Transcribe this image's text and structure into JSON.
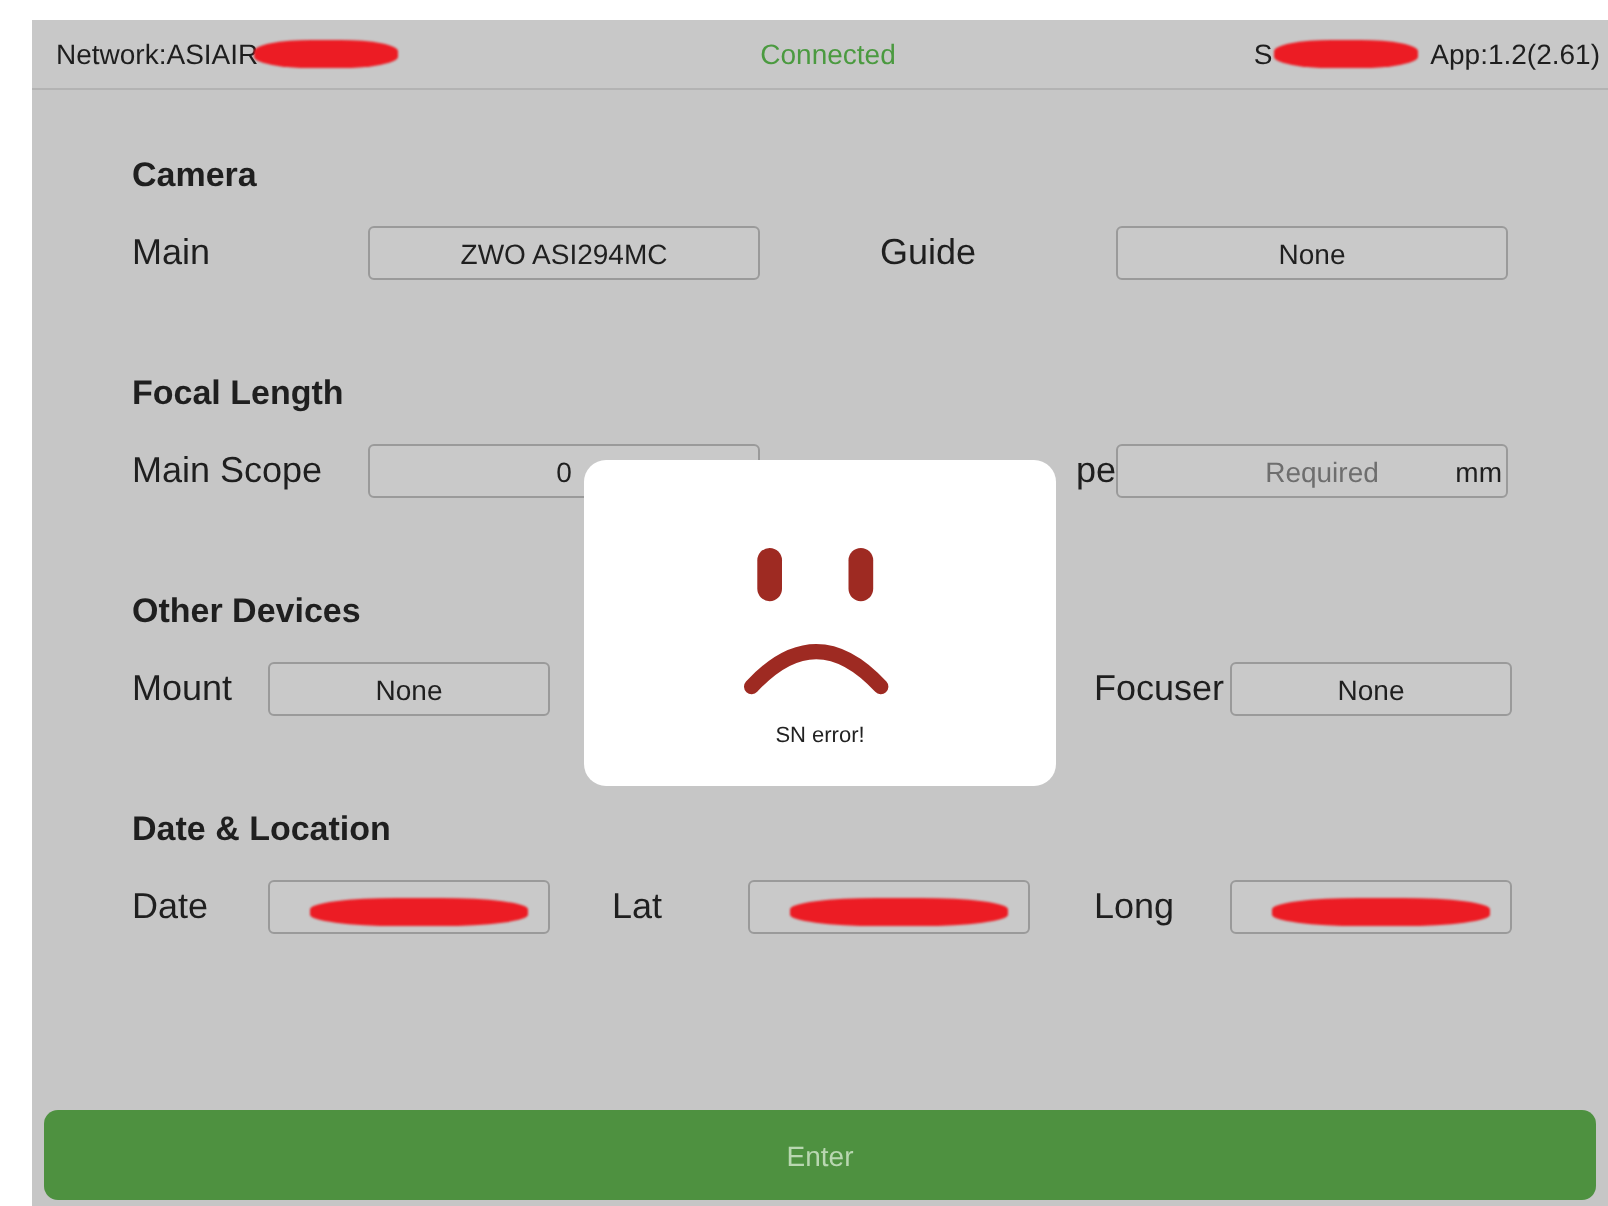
{
  "status_bar": {
    "network": "Network:ASIAIR",
    "network_redacted": true,
    "connection": "Connected",
    "serial": "S",
    "serial_redacted": true,
    "app_version": "App:1.2(2.61)"
  },
  "sections": [
    {
      "title": "Camera",
      "kind": "pair",
      "fields": [
        {
          "label": "Main",
          "value": "ZWO ASI294MC"
        },
        {
          "label": "Guide",
          "value": "None"
        }
      ]
    },
    {
      "title": "Focal Length",
      "kind": "pair",
      "fields": [
        {
          "label": "Main Scope",
          "value": "0"
        },
        {
          "label": "pe",
          "partly_covered": true,
          "placeholder": "Required",
          "unit": "mm"
        }
      ]
    },
    {
      "title": "Other Devices",
      "kind": "triple",
      "fields": [
        {
          "label": "Mount",
          "value": "None"
        },
        {
          "label": "Focuser",
          "value": "None"
        }
      ]
    },
    {
      "title": "Date & Location",
      "kind": "triple",
      "fields": [
        {
          "label": "Date",
          "redacted": true
        },
        {
          "label": "Lat",
          "redacted": true
        },
        {
          "label": "Long",
          "redacted": true
        }
      ]
    }
  ],
  "dialog": {
    "message": "SN error!"
  },
  "enter_button": {
    "label": "Enter"
  }
}
